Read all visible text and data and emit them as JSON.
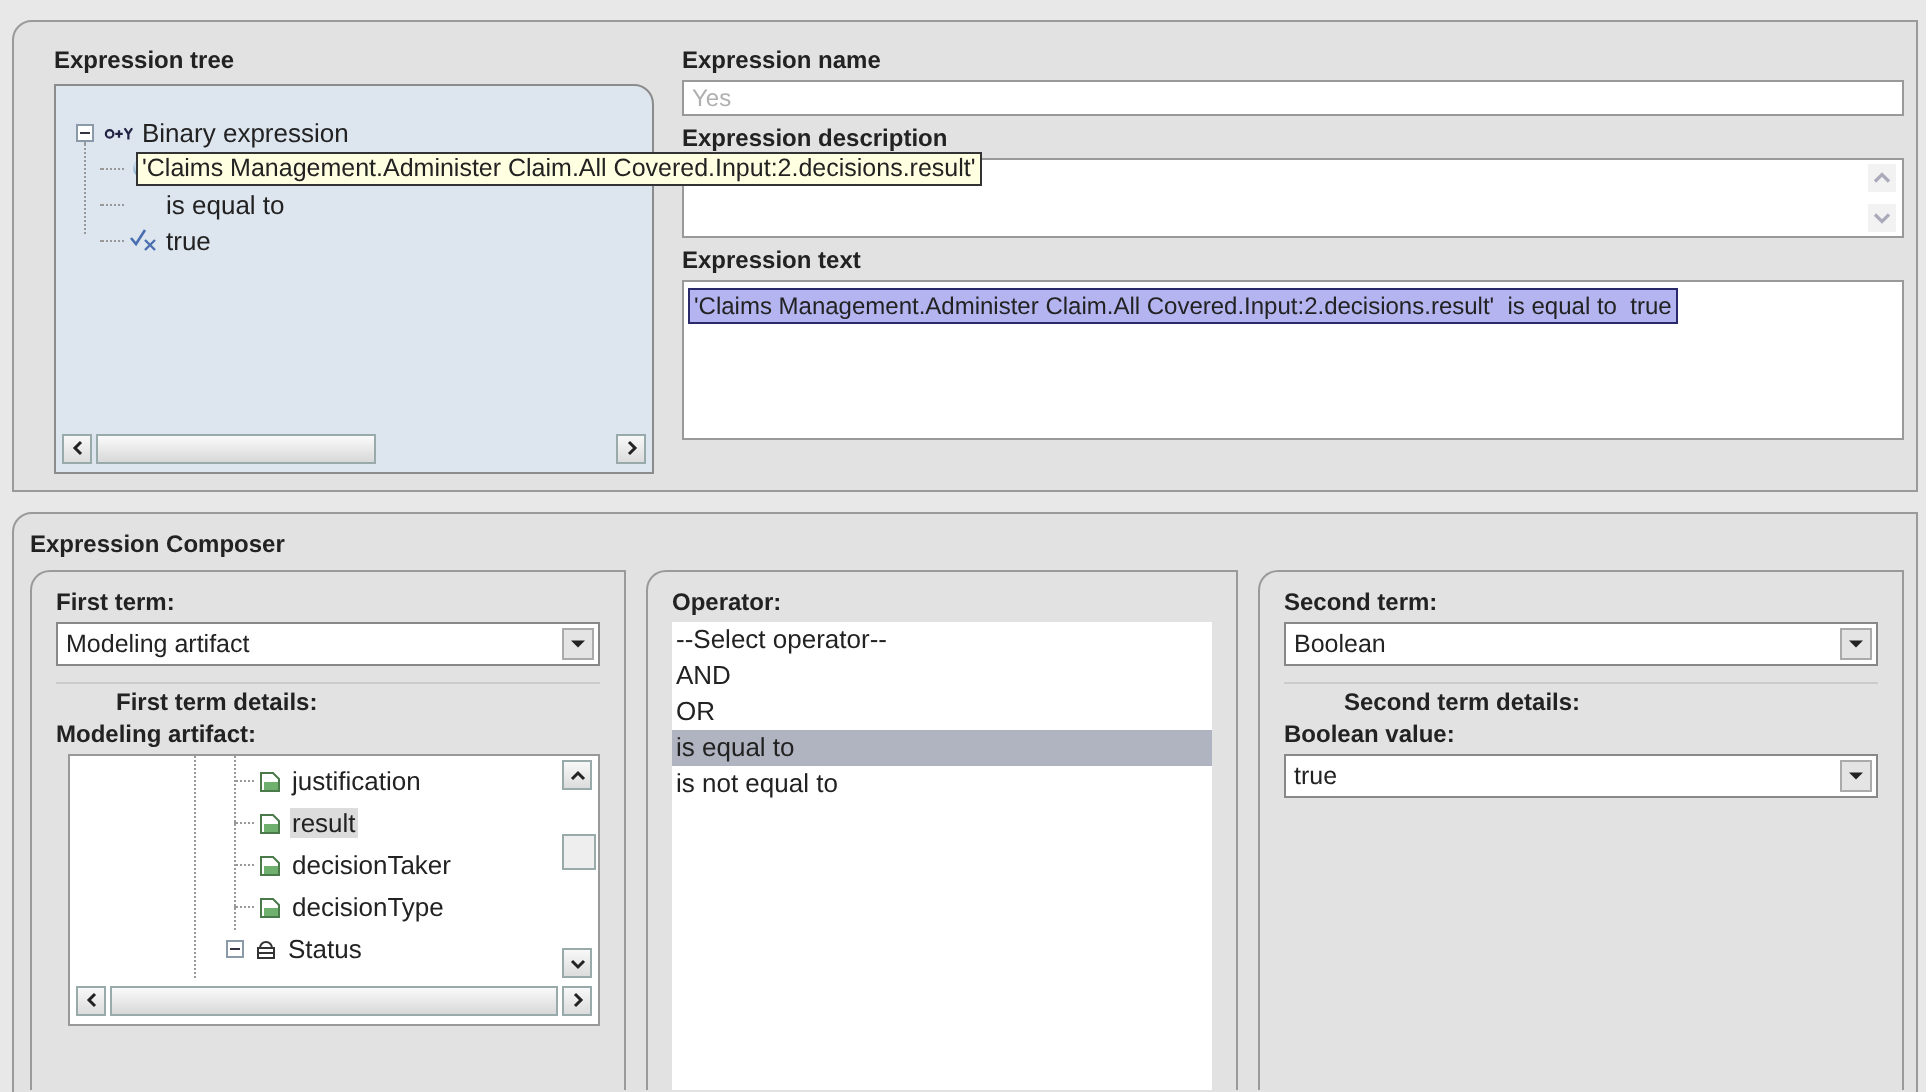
{
  "expression_tree": {
    "title": "Expression tree",
    "root": {
      "label": "Binary expression",
      "kind": "binary",
      "expanded": true,
      "children": [
        {
          "kind": "term",
          "label": "'Claims Management.Administer Claim.All Covered.Input:2.decisions.result'"
        },
        {
          "kind": "operator",
          "label": "is equal to"
        },
        {
          "kind": "value",
          "label": "true"
        }
      ]
    }
  },
  "expression_name": {
    "label": "Expression name",
    "placeholder": "Yes"
  },
  "expression_description": {
    "label": "Expression description"
  },
  "expression_text": {
    "label": "Expression text",
    "value": "'Claims Management.Administer Claim.All Covered.Input:2.decisions.result'  is equal to  true"
  },
  "composer": {
    "title": "Expression Composer",
    "first_term": {
      "label": "First term:",
      "value": "Modeling artifact",
      "details_title": "First term details:",
      "details_label": "Modeling artifact:",
      "tree": [
        {
          "kind": "field",
          "label": "justification",
          "selected": false
        },
        {
          "kind": "field",
          "label": "result",
          "selected": true
        },
        {
          "kind": "field",
          "label": "decisionTaker",
          "selected": false
        },
        {
          "kind": "field",
          "label": "decisionType",
          "selected": false
        },
        {
          "kind": "group",
          "label": "Status",
          "selected": false,
          "expanded": true
        }
      ]
    },
    "operator": {
      "label": "Operator:",
      "items": [
        {
          "label": "--Select operator--",
          "selected": false
        },
        {
          "label": "AND",
          "selected": false
        },
        {
          "label": "OR",
          "selected": false
        },
        {
          "label": "is equal to",
          "selected": true
        },
        {
          "label": "is not equal to",
          "selected": false
        }
      ]
    },
    "second_term": {
      "label": "Second term:",
      "value": "Boolean",
      "details_title": "Second term details:",
      "details_label": "Boolean value:",
      "detail_value": "true"
    }
  }
}
